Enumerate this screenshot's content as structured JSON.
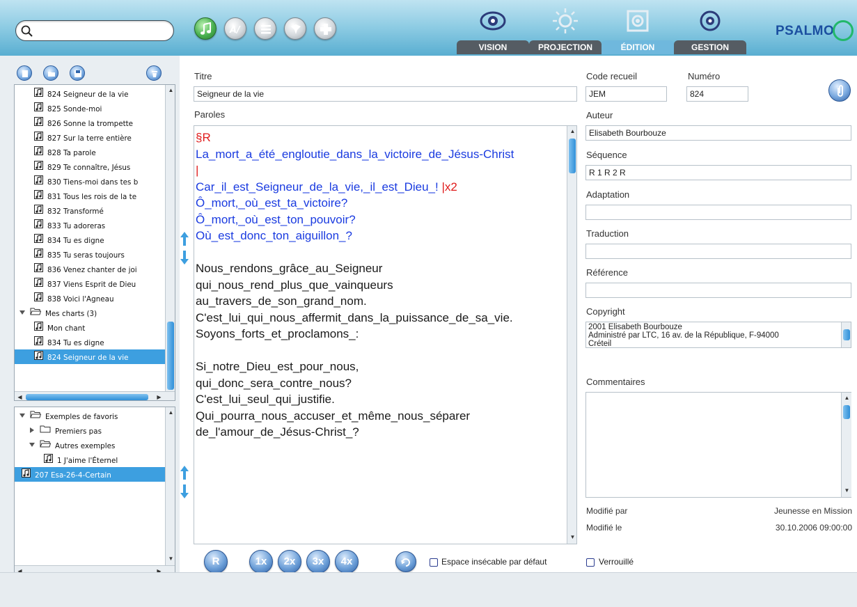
{
  "header": {
    "search_placeholder": "",
    "brand": "PSALMO",
    "toolbar_icons": [
      "music-note-icon",
      "text-icon",
      "list-icon",
      "settings-icon",
      "puzzle-icon"
    ],
    "modes": [
      {
        "label": "VISION",
        "icon": "eye-icon",
        "active": false
      },
      {
        "label": "PROJECTION",
        "icon": "projector-icon",
        "active": false
      },
      {
        "label": "ÉDITION",
        "icon": "edit-icon",
        "active": true
      },
      {
        "label": "GESTION",
        "icon": "gear-icon",
        "active": false
      }
    ]
  },
  "left_panel": {
    "file_buttons": [
      "new-file-icon",
      "open-file-icon",
      "save-icon",
      "trash-icon"
    ],
    "song_list": [
      {
        "label": "824 Seigneur de la vie",
        "type": "song",
        "indent": 1
      },
      {
        "label": "825 Sonde-moi",
        "type": "song",
        "indent": 1
      },
      {
        "label": "826 Sonne la trompette",
        "type": "song",
        "indent": 1
      },
      {
        "label": "827 Sur la terre entière",
        "type": "song",
        "indent": 1
      },
      {
        "label": "828 Ta parole",
        "type": "song",
        "indent": 1
      },
      {
        "label": "829 Te connaître, Jésus",
        "type": "song",
        "indent": 1
      },
      {
        "label": "830 Tiens-moi dans tes b",
        "type": "song",
        "indent": 1
      },
      {
        "label": "831 Tous les rois de la te",
        "type": "song",
        "indent": 1
      },
      {
        "label": "832 Transformé",
        "type": "song",
        "indent": 1
      },
      {
        "label": "833 Tu adoreras",
        "type": "song",
        "indent": 1
      },
      {
        "label": "834 Tu es digne",
        "type": "song",
        "indent": 1
      },
      {
        "label": "835 Tu seras toujours",
        "type": "song",
        "indent": 1
      },
      {
        "label": "836 Venez chanter de joi",
        "type": "song",
        "indent": 1
      },
      {
        "label": "837 Viens Esprit de Dieu",
        "type": "song",
        "indent": 1
      },
      {
        "label": "838 Voici l'Agneau",
        "type": "song",
        "indent": 1
      },
      {
        "label": "Mes charts (3)",
        "type": "folder-open",
        "indent": 0
      },
      {
        "label": "Mon chant",
        "type": "song",
        "indent": 1
      },
      {
        "label": "834 Tu es digne",
        "type": "song",
        "indent": 1
      },
      {
        "label": "824 Seigneur de la vie",
        "type": "song",
        "indent": 1,
        "selected": true
      }
    ],
    "favorites": [
      {
        "label": "Exemples de favoris",
        "type": "folder-open",
        "indent": 0
      },
      {
        "label": "Premiers pas",
        "type": "folder-closed",
        "indent": 1
      },
      {
        "label": "Autres exemples",
        "type": "folder-open",
        "indent": 1
      },
      {
        "label": "1 J'aime l'Éternel",
        "type": "song",
        "indent": 2
      },
      {
        "label": "207 Esa-26-4-Certain",
        "type": "song",
        "indent": 0,
        "selected": true
      }
    ]
  },
  "editor": {
    "title_label": "Titre",
    "title_value": "Seigneur de la vie",
    "lyrics_label": "Paroles",
    "lyrics_lines": [
      {
        "text": "§R",
        "color": "red"
      },
      {
        "text": "La_mort_a_été_engloutie_dans_la_victoire_de_Jésus-Christ",
        "color": "blue"
      },
      {
        "text": "|",
        "color": "red"
      },
      {
        "text": "Car_il_est_Seigneur_de_la_vie,_il_est_Dieu_!",
        "color": "blue",
        "suffix": " |x2"
      },
      {
        "text": "Ô_mort,_où_est_ta_victoire?",
        "color": "blue"
      },
      {
        "text": "Ô_mort,_où_est_ton_pouvoir?",
        "color": "blue"
      },
      {
        "text": "Où_est_donc_ton_aiguillon_?",
        "color": "blue"
      },
      {
        "text": "",
        "color": "black"
      },
      {
        "text": "Nous_rendons_grâce_au_Seigneur",
        "color": "black"
      },
      {
        "text": "qui_nous_rend_plus_que_vainqueurs",
        "color": "black"
      },
      {
        "text": "au_travers_de_son_grand_nom.",
        "color": "black"
      },
      {
        "text": "C'est_lui_qui_nous_affermit_dans_la_puissance_de_sa_vie.",
        "color": "black"
      },
      {
        "text": "Soyons_forts_et_proclamons_:",
        "color": "black"
      },
      {
        "text": "",
        "color": "black"
      },
      {
        "text": "Si_notre_Dieu_est_pour_nous,",
        "color": "black"
      },
      {
        "text": "qui_donc_sera_contre_nous?",
        "color": "black"
      },
      {
        "text": "C'est_lui_seul_qui_justifie.",
        "color": "black"
      },
      {
        "text": "Qui_pourra_nous_accuser_et_même_nous_séparer",
        "color": "black"
      },
      {
        "text": "de_l'amour_de_Jésus-Christ_?",
        "color": "black"
      }
    ],
    "bottom_buttons": [
      "R",
      "1x",
      "2x",
      "3x",
      "4x"
    ],
    "loop_icon": "loop-icon",
    "nbsp_checkbox_label": "Espace insécable par défaut",
    "nbsp_checked": false,
    "locked_checkbox_label": "Verrouillé",
    "locked_checked": false
  },
  "meta": {
    "code_label": "Code recueil",
    "code_value": "JEM",
    "number_label": "Numéro",
    "number_value": "824",
    "author_label": "Auteur",
    "author_value": "Elisabeth Bourbouze",
    "sequence_label": "Séquence",
    "sequence_value": "R 1 R 2 R",
    "adaptation_label": "Adaptation",
    "adaptation_value": "",
    "translation_label": "Traduction",
    "translation_value": "",
    "reference_label": "Référence",
    "reference_value": "",
    "copyright_label": "Copyright",
    "copyright_lines": [
      "2001 Elisabeth Bourbouze",
      "Administré par LTC, 16 av. de la République, F-94000",
      "Créteil"
    ],
    "comments_label": "Commentaires",
    "comments_value": "",
    "modified_by_label": "Modifié par",
    "modified_by_value": "Jeunesse en Mission",
    "modified_on_label": "Modifié le",
    "modified_on_value": "30.10.2006 09:00:00",
    "attach_icon": "paperclip-icon"
  },
  "colors": {
    "lyrics_red": "#e01b1b",
    "lyrics_blue": "#1a3be0",
    "selection": "#3d9fe0",
    "header_top": "#bfe3f1",
    "header_bottom": "#59aed1"
  }
}
